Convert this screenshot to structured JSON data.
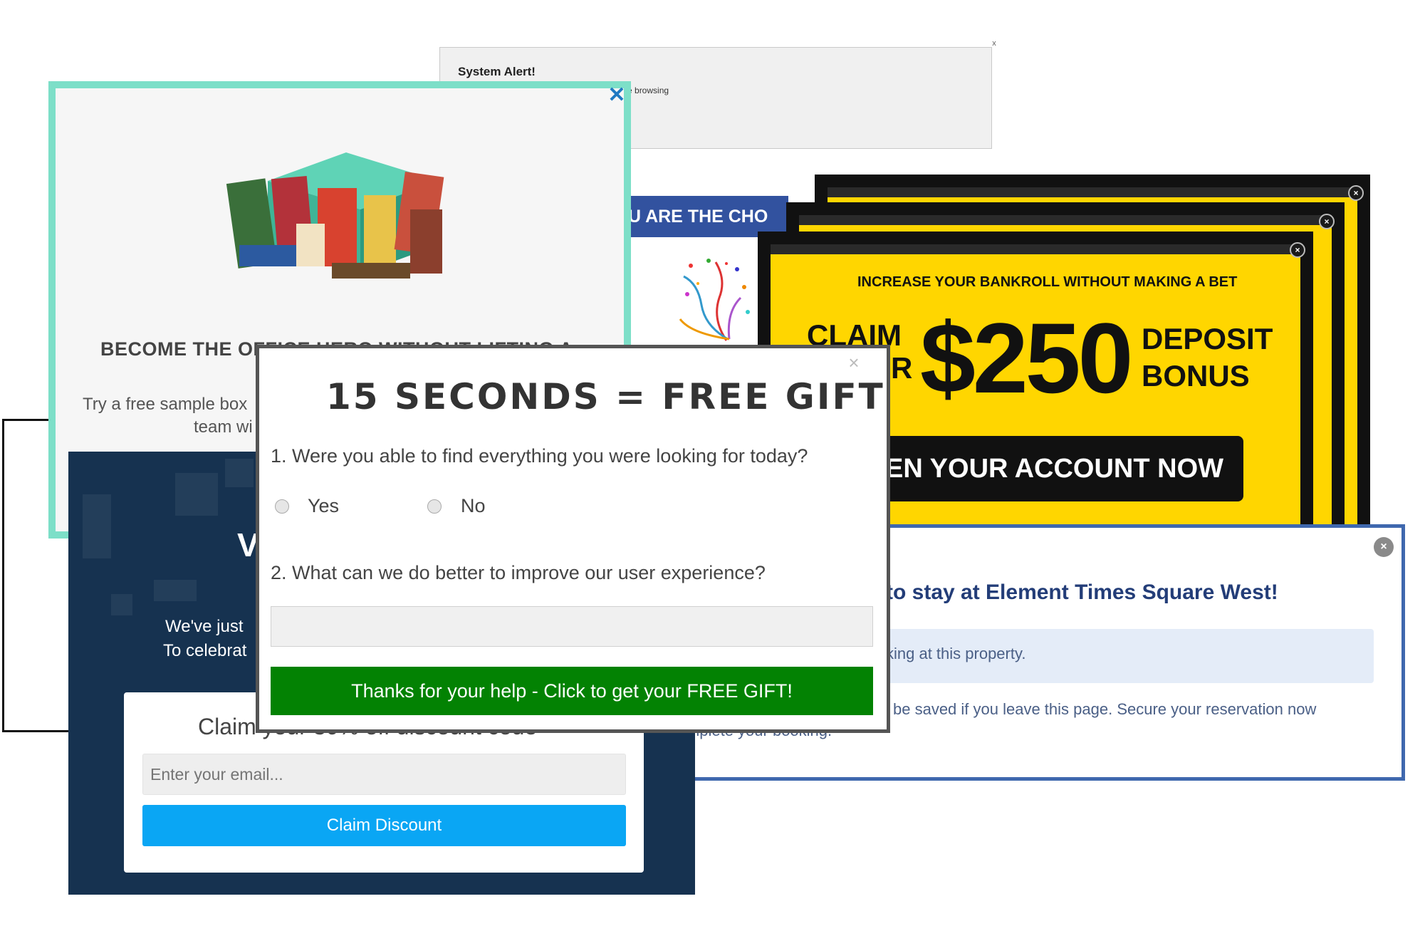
{
  "system_alert": {
    "title": "System Alert!",
    "body": "afe browsing",
    "close": "x"
  },
  "snack": {
    "headline": "BECOME THE OFFICE HERO WITHOUT LIFTING A",
    "sub_line1": "Try a free sample box",
    "sub_line2": "team wi",
    "close": "✕"
  },
  "chosen_banner": {
    "text": "U ARE THE CHO"
  },
  "casino": {
    "headline": "INCREASE YOUR BANKROLL WITHOUT MAKING A BET",
    "claim_line1": "CLAIM",
    "claim_line2": "R",
    "amount": "$250",
    "deposit_line1": "DEPOSIT",
    "deposit_line2": "BONUS",
    "button": "EN YOUR ACCOUNT NOW",
    "close": "×"
  },
  "hotel": {
    "title": "to stay at Element Times Square West!",
    "info": "king at this property.",
    "warning": "be saved if you leave this page. Secure your reservation now",
    "warning2": "nplete your booking.",
    "close": "×"
  },
  "discount": {
    "big_letter": "V",
    "line1": "We've just",
    "line2": "To celebrat",
    "claim_heading": "Claim your 30% off discount code",
    "email_placeholder": "Enter your email...",
    "button": "Claim Discount"
  },
  "survey": {
    "title": "15 SECONDS = FREE GIFT",
    "close": "×",
    "question1": "1. Were you able to find everything you were looking for today?",
    "option_yes": "Yes",
    "option_no": "No",
    "question2": "2. What can we do better to improve our user experience?",
    "button": "Thanks for your help - Click to get your FREE GIFT!"
  },
  "colors": {
    "snack_border": "#7ddfc8",
    "casino_yellow": "#ffd600",
    "hotel_border": "#3f68ae",
    "survey_button": "#038203",
    "discount_button": "#0aa6f4"
  }
}
